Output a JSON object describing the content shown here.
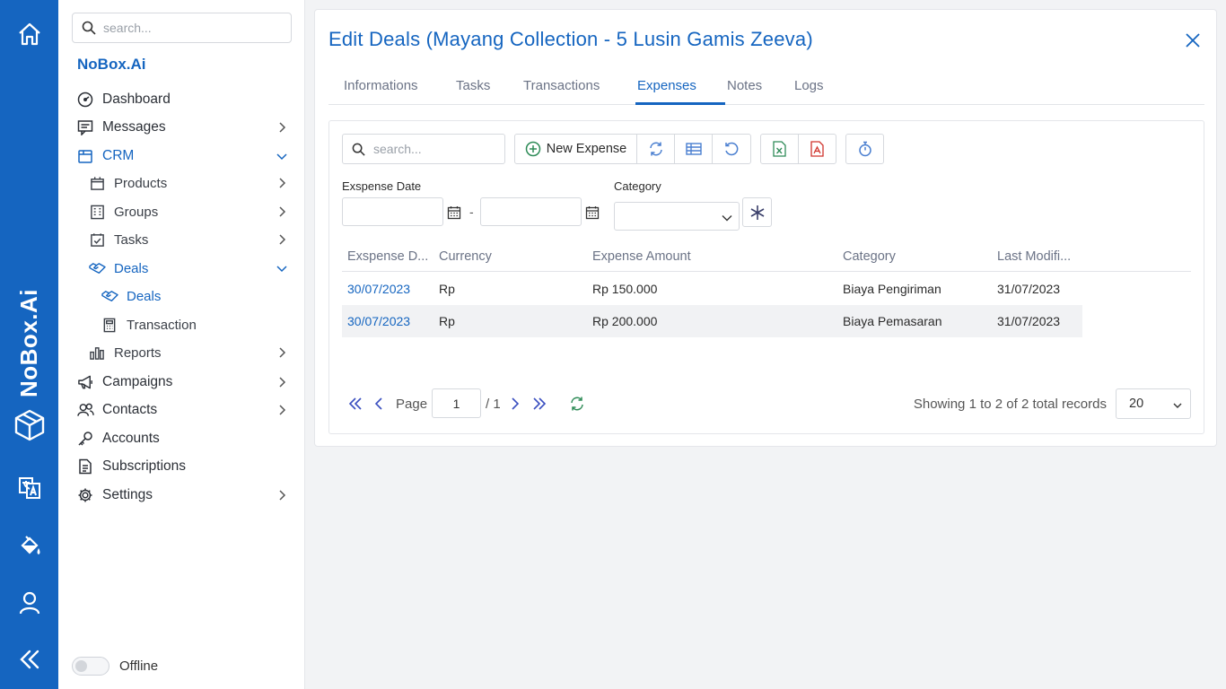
{
  "rail": {
    "brand": "NoBox.Ai",
    "icons": [
      "home-icon",
      "cube-logo-icon",
      "translate-icon",
      "paint-bucket-icon",
      "user-icon",
      "collapse-icon"
    ],
    "color": "#1565c0"
  },
  "sidebar": {
    "search_placeholder": "search...",
    "title": "NoBox.Ai",
    "items": [
      {
        "label": "Dashboard",
        "icon": "gauge-icon"
      },
      {
        "label": "Messages",
        "icon": "message-icon"
      },
      {
        "label": "CRM",
        "icon": "folder-icon"
      },
      {
        "label": "Products",
        "icon": "box-icon"
      },
      {
        "label": "Groups",
        "icon": "building-icon"
      },
      {
        "label": "Tasks",
        "icon": "calendar-check-icon"
      },
      {
        "label": "Deals",
        "icon": "handshake-icon"
      },
      {
        "label": "Deals",
        "icon": "handshake-icon"
      },
      {
        "label": "Transaction",
        "icon": "calculator-icon"
      },
      {
        "label": "Reports",
        "icon": "chart-icon"
      },
      {
        "label": "Campaigns",
        "icon": "megaphone-icon"
      },
      {
        "label": "Contacts",
        "icon": "users-icon"
      },
      {
        "label": "Accounts",
        "icon": "key-icon"
      },
      {
        "label": "Subscriptions",
        "icon": "document-icon"
      },
      {
        "label": "Settings",
        "icon": "gear-icon"
      }
    ],
    "offline_label": "Offline"
  },
  "panel": {
    "title": "Edit Deals (Mayang Collection - 5 Lusin Gamis Zeeva)",
    "tabs": [
      "Informations",
      "Tasks",
      "Transactions",
      "Expenses",
      "Notes",
      "Logs"
    ],
    "active_tab": "Expenses"
  },
  "toolbar": {
    "search_placeholder": "search...",
    "new_expense": "New Expense"
  },
  "filters": {
    "expense_date_label": "Exspense Date",
    "dash": "-",
    "category_label": "Category"
  },
  "grid": {
    "columns": [
      "Exspense D...",
      "Currency",
      "Expense Amount",
      "Category",
      "Last Modifi..."
    ],
    "rows": [
      [
        "30/07/2023",
        "Rp",
        "Rp 150.000",
        "Biaya Pengiriman",
        "31/07/2023"
      ],
      [
        "30/07/2023",
        "Rp",
        "Rp 200.000",
        "Biaya Pemasaran",
        "31/07/2023"
      ]
    ]
  },
  "pager": {
    "page_label": "Page",
    "page_value": "1",
    "total_pages": "/ 1",
    "showing": "Showing 1 to 2 of 2 total records",
    "page_size": "20"
  }
}
